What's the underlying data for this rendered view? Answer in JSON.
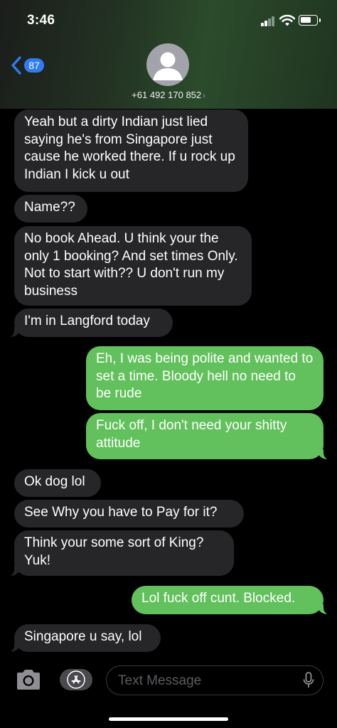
{
  "status": {
    "time": "3:46"
  },
  "nav": {
    "back_count": "87",
    "contact": "+61 492 170 852",
    "contact_chevron": "›"
  },
  "messages": [
    {
      "dir": "in",
      "text": "Yeah but a dirty Indian just lied saying he's from Singapore just cause he worked there. If u rock up Indian I kick u out"
    },
    {
      "dir": "in",
      "text": "Name??"
    },
    {
      "dir": "in",
      "text": "No book Ahead. U think your the only 1 booking? And set times Only. Not to start with?? U don't run my business"
    },
    {
      "dir": "in",
      "text": "I'm in Langford today"
    },
    {
      "dir": "out",
      "text": "Eh, I was being polite and wanted to set a time. Bloody hell no need to be rude"
    },
    {
      "dir": "out",
      "text": "Fuck off, I don't need your shitty attitude"
    },
    {
      "dir": "in",
      "text": "Ok dog lol"
    },
    {
      "dir": "in",
      "text": "See Why you have to Pay for it?"
    },
    {
      "dir": "in",
      "text": "Think your some sort of King? Yuk!"
    },
    {
      "dir": "out",
      "text": "Lol fuck off cunt. Blocked."
    },
    {
      "dir": "in",
      "text": "Singapore u say, lol"
    }
  ],
  "composer": {
    "placeholder": "Text Message"
  },
  "colors": {
    "incoming_bubble": "#262629",
    "outgoing_bubble": "#62c15c",
    "badge": "#2f7cf6"
  },
  "icons": [
    "signal-icon",
    "wifi-icon",
    "battery-icon",
    "back-chevron-icon",
    "contact-avatar-icon",
    "camera-icon",
    "app-store-icon",
    "microphone-icon"
  ]
}
